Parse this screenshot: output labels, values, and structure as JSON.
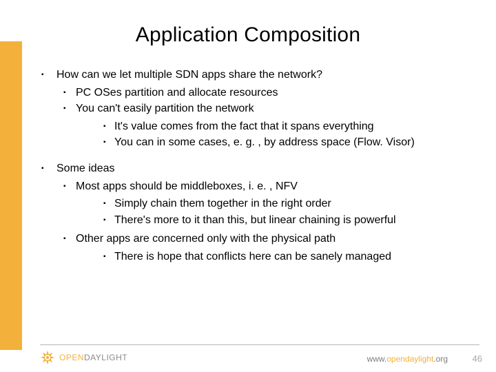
{
  "title": "Application Composition",
  "bullets": [
    {
      "text": "How can we let multiple SDN apps share the network?",
      "children": [
        {
          "text": "PC OSes partition and allocate resources",
          "children": []
        },
        {
          "text": "You can't easily partition the network",
          "children2": [
            {
              "text": "It's value comes from the fact that it spans everything"
            },
            {
              "text": "You can in some cases, e. g. , by address space (Flow. Visor)"
            }
          ]
        }
      ]
    },
    {
      "text": "Some ideas",
      "children": [
        {
          "text": "Most apps should be middleboxes, i. e. , NFV",
          "children2": [
            {
              "text": "Simply chain them together in the right order"
            },
            {
              "text": "There's more to it than this, but linear chaining is powerful"
            }
          ]
        },
        {
          "text": "Other apps are concerned only with the physical path",
          "children3": [
            {
              "text": "There is hope that conflicts here can be sanely managed"
            }
          ]
        }
      ]
    }
  ],
  "logo": {
    "open": "OPEN",
    "daylight": "DAYLIGHT"
  },
  "footer_url_prefix": "www.",
  "footer_url_accent": "opendaylight",
  "footer_url_suffix": ".org",
  "page_number": "46"
}
